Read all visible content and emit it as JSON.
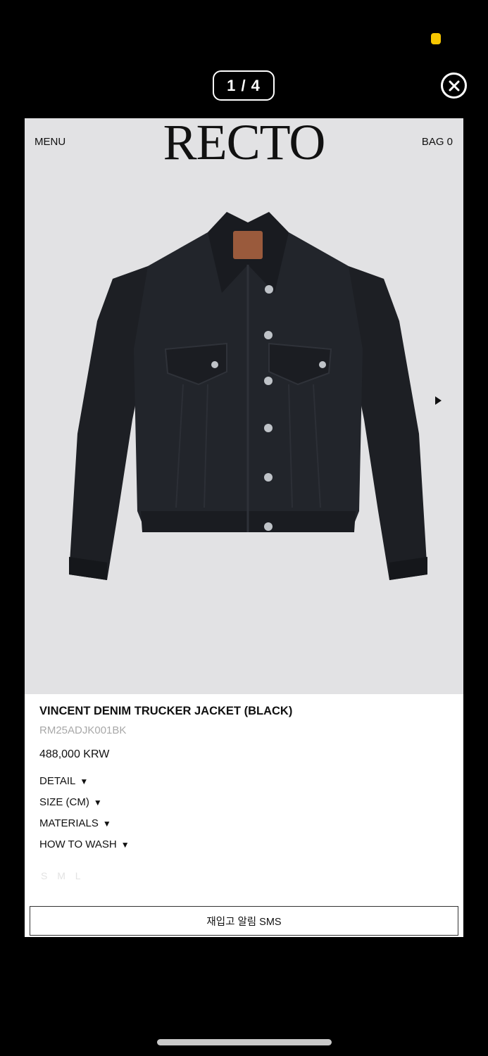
{
  "status": {
    "indicator_color": "#f7c600"
  },
  "viewer": {
    "counter": "1 / 4",
    "close_icon": "close-circle-icon",
    "next_icon": "triangle-right-icon"
  },
  "site": {
    "menu_label": "MENU",
    "logo_text": "RECTO",
    "bag_label": "BAG 0"
  },
  "product": {
    "image": "black-denim-trucker-jacket-photo",
    "title": "VINCENT DENIM TRUCKER JACKET (BLACK)",
    "sku": "RM25ADJK001BK",
    "price": "488,000 KRW",
    "sections": [
      {
        "label": "DETAIL",
        "caret": "▼"
      },
      {
        "label": "SIZE (CM)",
        "caret": "▼"
      },
      {
        "label": "MATERIALS",
        "caret": "▼"
      },
      {
        "label": "HOW TO WASH",
        "caret": "▼"
      }
    ],
    "sizes": [
      "S",
      "M",
      "L"
    ],
    "restock_sms_label": "재입고 알림 SMS"
  },
  "colors": {
    "background": "#000000",
    "hero_bg": "#e2e2e4",
    "size_disabled": "#e3e3e3",
    "sku_gray": "#a8a8a8"
  }
}
